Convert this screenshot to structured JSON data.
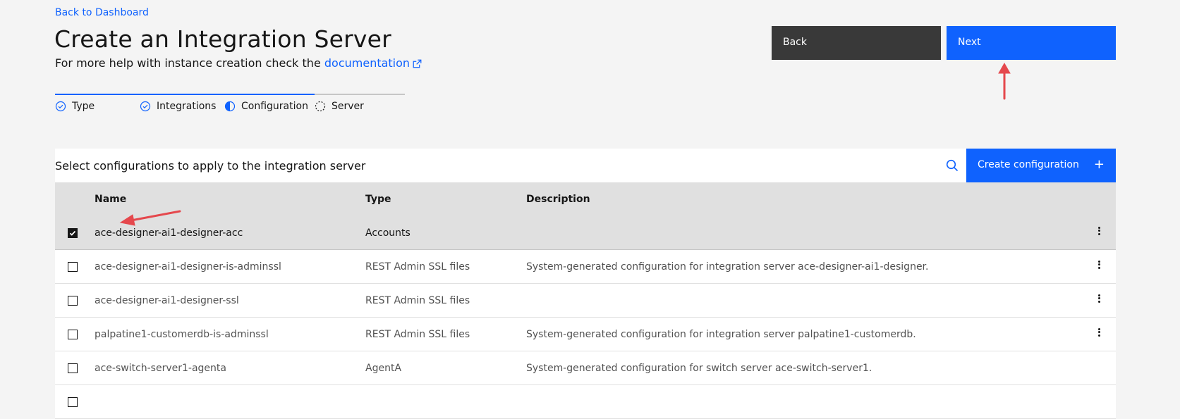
{
  "nav": {
    "back_link": "Back to Dashboard"
  },
  "header": {
    "title": "Create an Integration Server",
    "subtitle_prefix": "For more help with instance creation check the ",
    "doc_link": "documentation",
    "doc_link_icon": "external-link-icon"
  },
  "actions": {
    "back_label": "Back",
    "next_label": "Next"
  },
  "progress": {
    "steps": [
      {
        "label": "Type",
        "state": "complete"
      },
      {
        "label": "Integrations",
        "state": "complete"
      },
      {
        "label": "Configuration",
        "state": "current"
      },
      {
        "label": "Server",
        "state": "incomplete"
      }
    ]
  },
  "toolbar": {
    "title": "Select configurations to apply to the integration server",
    "search_icon": "search-icon",
    "create_label": "Create configuration",
    "create_icon": "+"
  },
  "table": {
    "headers": {
      "name": "Name",
      "type": "Type",
      "description": "Description"
    },
    "rows": [
      {
        "checked": true,
        "name": "ace-designer-ai1-designer-acc",
        "type": "Accounts",
        "description": "",
        "menu": true
      },
      {
        "checked": false,
        "name": "ace-designer-ai1-designer-is-adminssl",
        "type": "REST Admin SSL files",
        "description": "System-generated configuration for integration server ace-designer-ai1-designer.",
        "menu": true
      },
      {
        "checked": false,
        "name": "ace-designer-ai1-designer-ssl",
        "type": "REST Admin SSL files",
        "description": "",
        "menu": true
      },
      {
        "checked": false,
        "name": "palpatine1-customerdb-is-adminssl",
        "type": "REST Admin SSL files",
        "description": "System-generated configuration for integration server palpatine1-customerdb.",
        "menu": true
      },
      {
        "checked": false,
        "name": "ace-switch-server1-agenta",
        "type": "AgentA",
        "description": "System-generated configuration for switch server ace-switch-server1.",
        "menu": false
      }
    ]
  },
  "colors": {
    "accent": "#0f62fe",
    "secondary_button": "#393939",
    "annotation_arrow": "#e5484d"
  }
}
